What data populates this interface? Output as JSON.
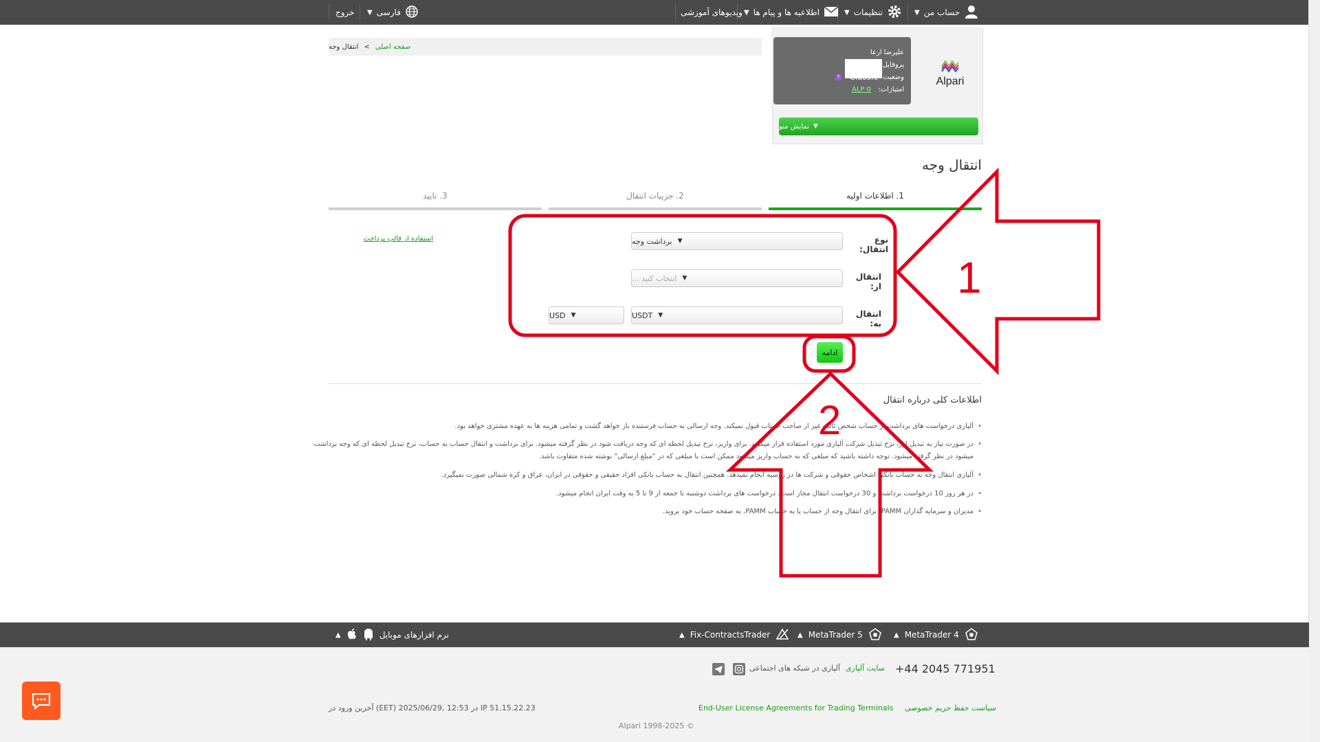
{
  "topbar": {
    "account": "حساب من",
    "settings": "تنظیمات",
    "notifications": "اطلاعیه ها و پیام ها",
    "videos": "ویدیوهای آموزشی",
    "language": "فارسی",
    "logout": "خروج"
  },
  "profile": {
    "logo_text": "Alpari",
    "line1": "علیرضا ارعا",
    "line2_label": "پروفایل",
    "line3_label": "وضعیت",
    "status": "Classic",
    "line4_label": "امتیازات:",
    "points": "ALP 0",
    "menu_button": "نمایش منو"
  },
  "breadcrumb": {
    "home": "صفحه اصلی",
    "separator": ">",
    "current": "انتقال وجه"
  },
  "page_title": "انتقال وجه",
  "tabs": [
    {
      "label": "1. اطلاعات اولیه"
    },
    {
      "label": "2. جزییات انتقال"
    },
    {
      "label": "3. تایید"
    }
  ],
  "form": {
    "transfer_type_label": "نوع انتقال:",
    "transfer_type_value": "برداشت وجه",
    "from_label": "انتقال از:",
    "from_placeholder": "انتخاب کنید ...",
    "to_label": "انتقال به:",
    "to_value": "USDT",
    "currency_value": "USD",
    "template_link": "استفاده از قالب پرداخت",
    "continue_button": "ادامه"
  },
  "info": {
    "title": "اطلاعات کلی درباره انتقال",
    "items": [
      "آلپاری درخواست های برداشت از حساب شخص ثالث غیر از صاحب حساب قبول نمیکند. وجه ارسالی به حساب فرستنده باز خواهد گشت و تمامی هزینه ها به عهده مشتری خواهد بود.",
      "در صورت نیاز به تبدیل ارز، نرخ تبدیل شرکت آلپاری مورد استفاده قرار میگیرد. برای واریز، نرخ تبدیل لحظه ای که وجه دریافت شود در نظر گرفته میشود. برای برداشت و انتقال حساب به حساب، نرخ تبدیل لحظه ای که وجه برداشت",
      "میشود در نظر گرفته میشود. توجه داشته باشید که مبلغی که به حساب واریز میشود ممکن است با مبلغی که در \"مبلغ ارسالی\" نوشته شده متفاوت باشد.",
      "آلپاری انتقال وجه به حساب بانکی اشخاص حقوقی و شرکت ها در روسیه انجام نمیدهد. همچنین انتقال به حساب بانکی افراد حقیقی و حقوقی در ایران، عراق و کره شمالی صورت نمیگیرد.",
      "در هر روز 10 درخواست برداشت و 30 درخواست انتقال مجاز است. درخواست های برداشت دوشنبه تا جمعه از 9 تا 5 به وقت ایران انجام میشود.",
      "مدیران و سرمایه گذاران PAMM: برای انتقال وجه از حساب یا به حساب PAMM، به صفحه حساب خود بروید."
    ]
  },
  "annotations": {
    "label1": "1",
    "label2": "2",
    "color": "#e0001a"
  },
  "bottom_bar": {
    "mt4": "MetaTrader 4",
    "mt5": "MetaTrader 5",
    "fix": "Fix-ContractsTrader",
    "mobile": "نرم افزارهای موبایل"
  },
  "footer": {
    "phone": "+44 2045 771951",
    "site": "سایت آلپاری",
    "social": "آلپاری در شبکه های اجتماعی",
    "privacy": "سیاست حفظ حریم خصوصی",
    "eula": "End-User License Agreements for Trading Terminals",
    "last_login": "آخرین ورود در (EET) در 12:53 ,2025/06/29 IP 51.15.22.23",
    "copyright": "Alpari 1998-2025 ©"
  },
  "colors": {
    "green": "#1ea51e",
    "dark_bar": "#4a4a4a",
    "chat": "#ff5a1f"
  }
}
